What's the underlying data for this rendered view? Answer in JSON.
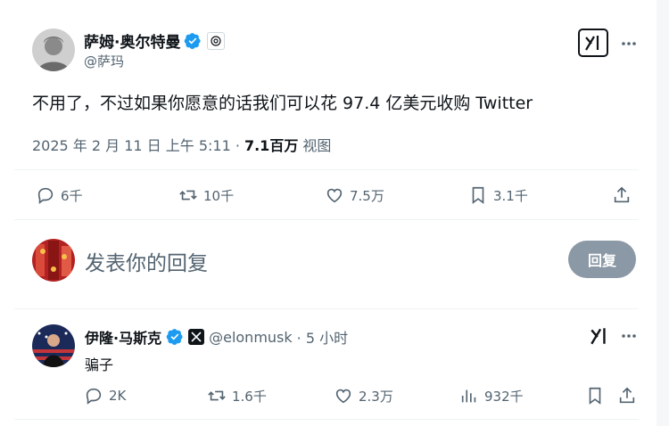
{
  "main_tweet": {
    "display_name": "萨姆·奥尔特曼",
    "handle": "@萨玛",
    "text": "不用了，不过如果你愿意的话我们可以花 97.4 亿美元收购 Twitter",
    "timestamp": "2025 年 2 月 11 日 上午 5:11 ·",
    "views_count": "7.1百万",
    "views_label": "视图",
    "stats": {
      "replies": "6千",
      "retweets": "10千",
      "likes": "7.5万",
      "bookmarks": "3.1千"
    }
  },
  "compose": {
    "placeholder": "发表你的回复",
    "button_label": "回复"
  },
  "reply_tweet": {
    "display_name": "伊隆·马斯克",
    "handle": "@elonmusk",
    "time": "· 5 小时",
    "text": "骗子",
    "stats": {
      "replies": "2K",
      "retweets": "1.6千",
      "likes": "2.3万",
      "views": "932千"
    }
  },
  "colors": {
    "verified": "#1d9bf0",
    "muted": "#536471",
    "reply_button": "#8b98a5",
    "divider": "#eff3f4"
  },
  "icons": [
    "verified-badge-icon",
    "openai-logo-icon",
    "grok-icon",
    "more-icon",
    "reply-icon",
    "retweet-icon",
    "like-icon",
    "bookmark-icon",
    "share-icon",
    "views-icon",
    "x-logo-icon"
  ]
}
